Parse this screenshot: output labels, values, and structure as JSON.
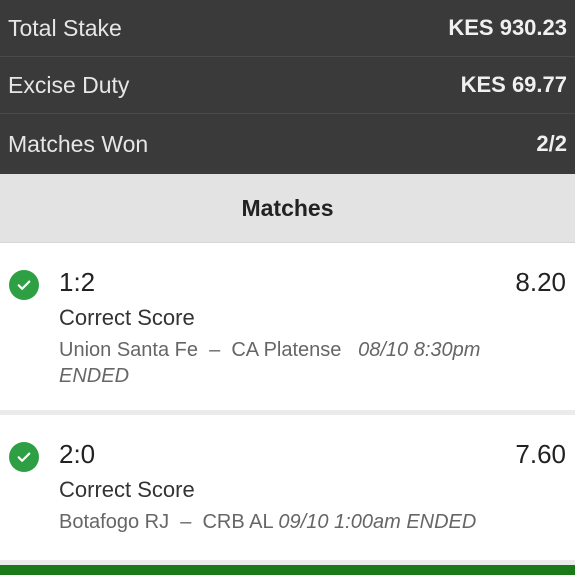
{
  "summary": {
    "rows": [
      {
        "label": "Total Stake",
        "value": "KES 930.23"
      },
      {
        "label": "Excise Duty",
        "value": "KES 69.77"
      },
      {
        "label": "Matches Won",
        "value": "2/2"
      }
    ]
  },
  "matches_section": {
    "title": "Matches",
    "items": [
      {
        "score": "1:2",
        "odds": "8.20",
        "market": "Correct Score",
        "home": "Union Santa Fe",
        "separator": "–",
        "away": "CA Platense",
        "datetime": "08/10 8:30pm",
        "status": "ENDED",
        "status_icon": "check-icon"
      },
      {
        "score": "2:0",
        "odds": "7.60",
        "market": "Correct Score",
        "home": "Botafogo RJ",
        "separator": "–",
        "away": "CRB AL",
        "datetime": "09/10 1:00am",
        "status": "ENDED",
        "status_icon": "check-icon"
      }
    ]
  },
  "colors": {
    "summary_bg": "#3a3a3a",
    "header_bg": "#e3e3e3",
    "won_green": "#2ea043",
    "bottom_bar": "#1a7a1a"
  }
}
